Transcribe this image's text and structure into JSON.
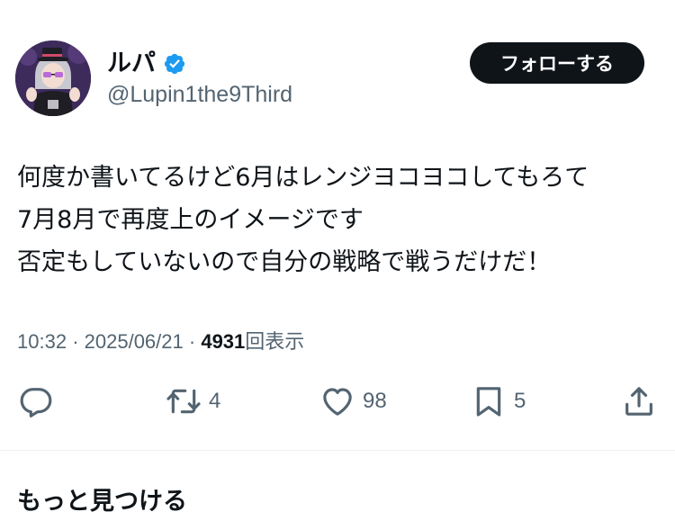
{
  "author": {
    "display_name": "ルパ",
    "handle": "@Lupin1the9Third",
    "verified": true
  },
  "follow_button_label": "フォローする",
  "tweet": {
    "lines": [
      "何度か書いてるけど6月はレンジヨコヨコしてもろて",
      "7月8月で再度上のイメージです",
      "否定もしていないので自分の戦略で戦うだけだ！"
    ]
  },
  "meta": {
    "time": "10:32",
    "separator": "·",
    "date": "2025/06/21",
    "views_count": "4931",
    "views_label": "回表示"
  },
  "actions": {
    "reply": {
      "icon": "reply-icon",
      "count": ""
    },
    "retweet": {
      "icon": "retweet-icon",
      "count": "4"
    },
    "like": {
      "icon": "heart-icon",
      "count": "98"
    },
    "bookmark": {
      "icon": "bookmark-icon",
      "count": "5"
    },
    "share": {
      "icon": "share-icon",
      "count": ""
    }
  },
  "section": {
    "title": "もっと見つける"
  },
  "colors": {
    "text_primary": "#0f1419",
    "text_secondary": "#536471",
    "verified_blue": "#1d9bf0",
    "button_bg": "#0f1419",
    "divider": "#eff3f4"
  }
}
